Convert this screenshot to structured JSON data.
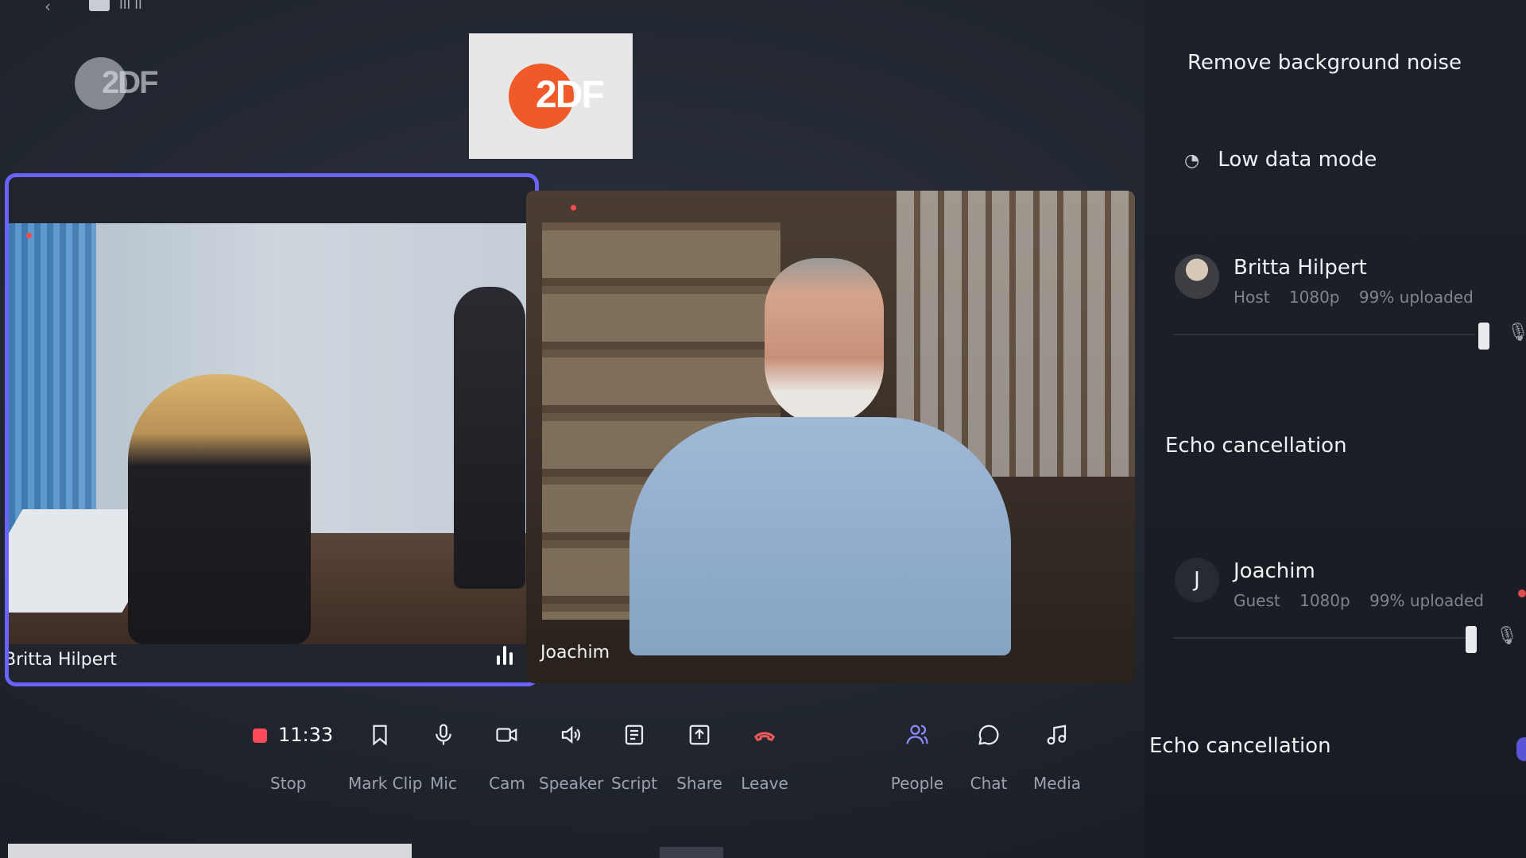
{
  "topbar": {
    "back_glyph": "‹",
    "tab_text": "III II"
  },
  "watermark": {
    "text": "2DF"
  },
  "logo_card": {
    "text": "2DF",
    "brand_color": "#ef5a28"
  },
  "tiles": [
    {
      "name": "Britta Hilpert",
      "speaking": true,
      "accent": "#6b63ff"
    },
    {
      "name": "Joachim",
      "speaking": false
    }
  ],
  "toolbar": {
    "timer": "11:33",
    "items": [
      {
        "label": "Stop",
        "icon": "record-icon"
      },
      {
        "label": "Mark Clip",
        "icon": "bookmark-icon"
      },
      {
        "label": "Mic",
        "icon": "microphone-icon"
      },
      {
        "label": "Cam",
        "icon": "camera-icon"
      },
      {
        "label": "Speaker",
        "icon": "speaker-icon"
      },
      {
        "label": "Script",
        "icon": "document-icon"
      },
      {
        "label": "Share",
        "icon": "share-icon"
      },
      {
        "label": "Leave",
        "icon": "hangup-icon"
      },
      {
        "label": "People",
        "icon": "people-icon"
      },
      {
        "label": "Chat",
        "icon": "chat-icon"
      },
      {
        "label": "Media",
        "icon": "music-icon"
      }
    ]
  },
  "panel": {
    "settings": {
      "noise": "Remove background noise",
      "low_data": "Low data mode",
      "echo1": "Echo cancellation",
      "echo2": "Echo cancellation"
    },
    "participants": [
      {
        "name": "Britta Hilpert",
        "role": "Host",
        "quality": "1080p",
        "upload": "99% uploaded"
      },
      {
        "name": "Joachim",
        "initial": "J",
        "role": "Guest",
        "quality": "1080p",
        "upload": "99% uploaded"
      }
    ]
  },
  "colors": {
    "accent": "#6b63ff",
    "record": "#ff4b5a",
    "leave": "#f05a5a",
    "background": "#1b1f27"
  }
}
